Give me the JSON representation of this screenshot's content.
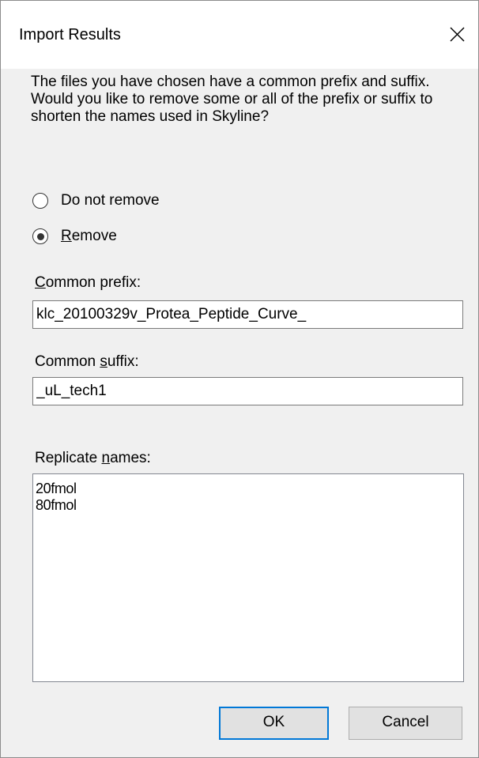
{
  "dialog": {
    "title": "Import Results",
    "message_line1": "The files you have chosen have a common prefix and suffix.",
    "message_line2": "Would you like to remove some or all of the prefix or suffix to shorten the names used in Skyline?"
  },
  "options": {
    "do_not_remove": {
      "label": "Do not remove",
      "checked": false
    },
    "remove": {
      "label_mnemonic": "R",
      "label_rest": "emove",
      "checked": true
    }
  },
  "prefix": {
    "label_mnemonic": "C",
    "label_rest": "ommon prefix:",
    "value": "klc_20100329v_Protea_Peptide_Curve_"
  },
  "suffix": {
    "label_before": "Common ",
    "label_mnemonic": "s",
    "label_after": "uffix:",
    "value": "_uL_tech1"
  },
  "replicates": {
    "label_before": "Replicate ",
    "label_mnemonic": "n",
    "label_after": "ames:",
    "items": [
      "20fmol",
      "80fmol"
    ]
  },
  "buttons": {
    "ok": "OK",
    "cancel": "Cancel"
  },
  "icons": {
    "close": "close-icon"
  },
  "colors": {
    "dialog_background": "#f0f0f0",
    "titlebar_background": "#ffffff",
    "default_button_border": "#0078d7",
    "button_background": "#e1e1e1"
  }
}
